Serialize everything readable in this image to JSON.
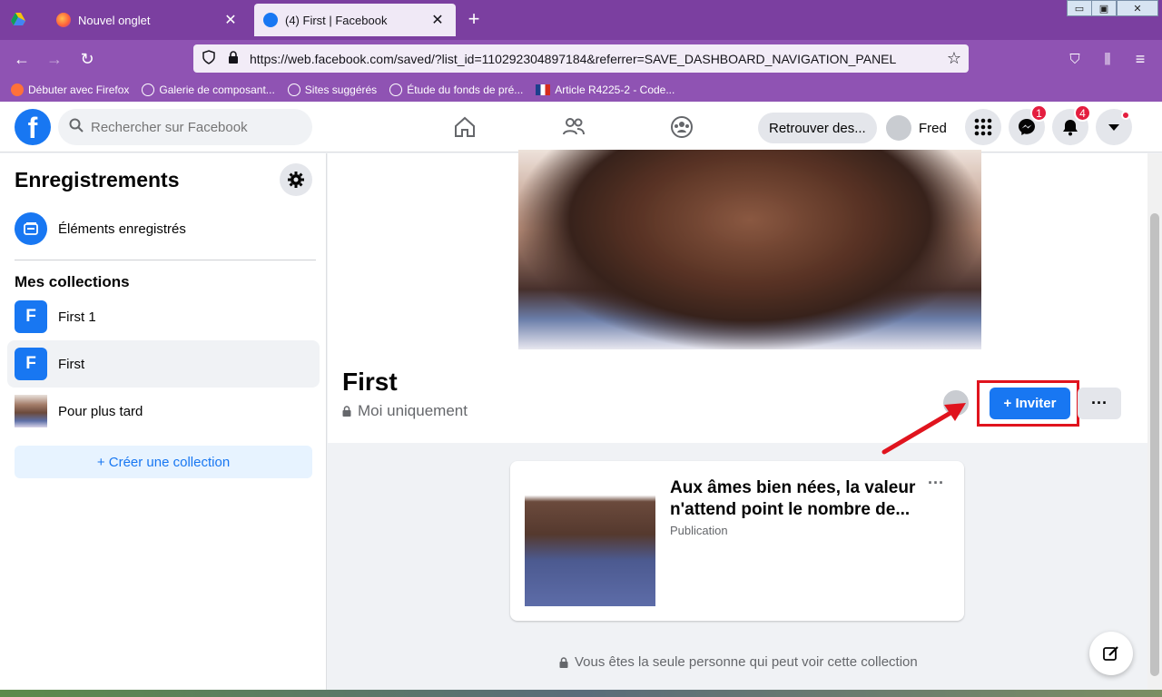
{
  "browser": {
    "tabs": [
      {
        "label": "Nouvel onglet",
        "close": "✕"
      },
      {
        "label": "(4) First | Facebook",
        "close": "✕"
      }
    ],
    "new_tab": "+",
    "url": "https://web.facebook.com/saved/?list_id=110292304897184&referrer=SAVE_DASHBOARD_NAVIGATION_PANEL",
    "bookmarks": [
      "Débuter avec Firefox",
      "Galerie de composant...",
      "Sites suggérés",
      "Étude du fonds de pré...",
      "Article R4225-2 - Code..."
    ]
  },
  "header": {
    "logo": "f",
    "search_placeholder": "Rechercher sur Facebook",
    "retrouver_label": "Retrouver des...",
    "profile_name": "Fred",
    "messenger_badge": "1",
    "notifications_badge": "4",
    "accent_color": "#1877f2"
  },
  "sidebar": {
    "title": "Enregistrements",
    "saved_items_label": "Éléments enregistrés",
    "collections_heading": "Mes collections",
    "collections": [
      {
        "letter": "F",
        "label": "First 1"
      },
      {
        "letter": "F",
        "label": "First"
      },
      {
        "letter": "",
        "label": "Pour plus tard"
      }
    ],
    "create_label": "+ Créer une collection"
  },
  "main": {
    "collection_title": "First",
    "privacy_label": "Moi uniquement",
    "invite_label": "+ Inviter",
    "more_label": "···",
    "card": {
      "title": "Aux âmes bien nées, la valeur n'attend point le nombre de...",
      "type": "Publication",
      "more": "···"
    },
    "footer_note": "Vous êtes la seule personne qui peut voir cette collection"
  }
}
